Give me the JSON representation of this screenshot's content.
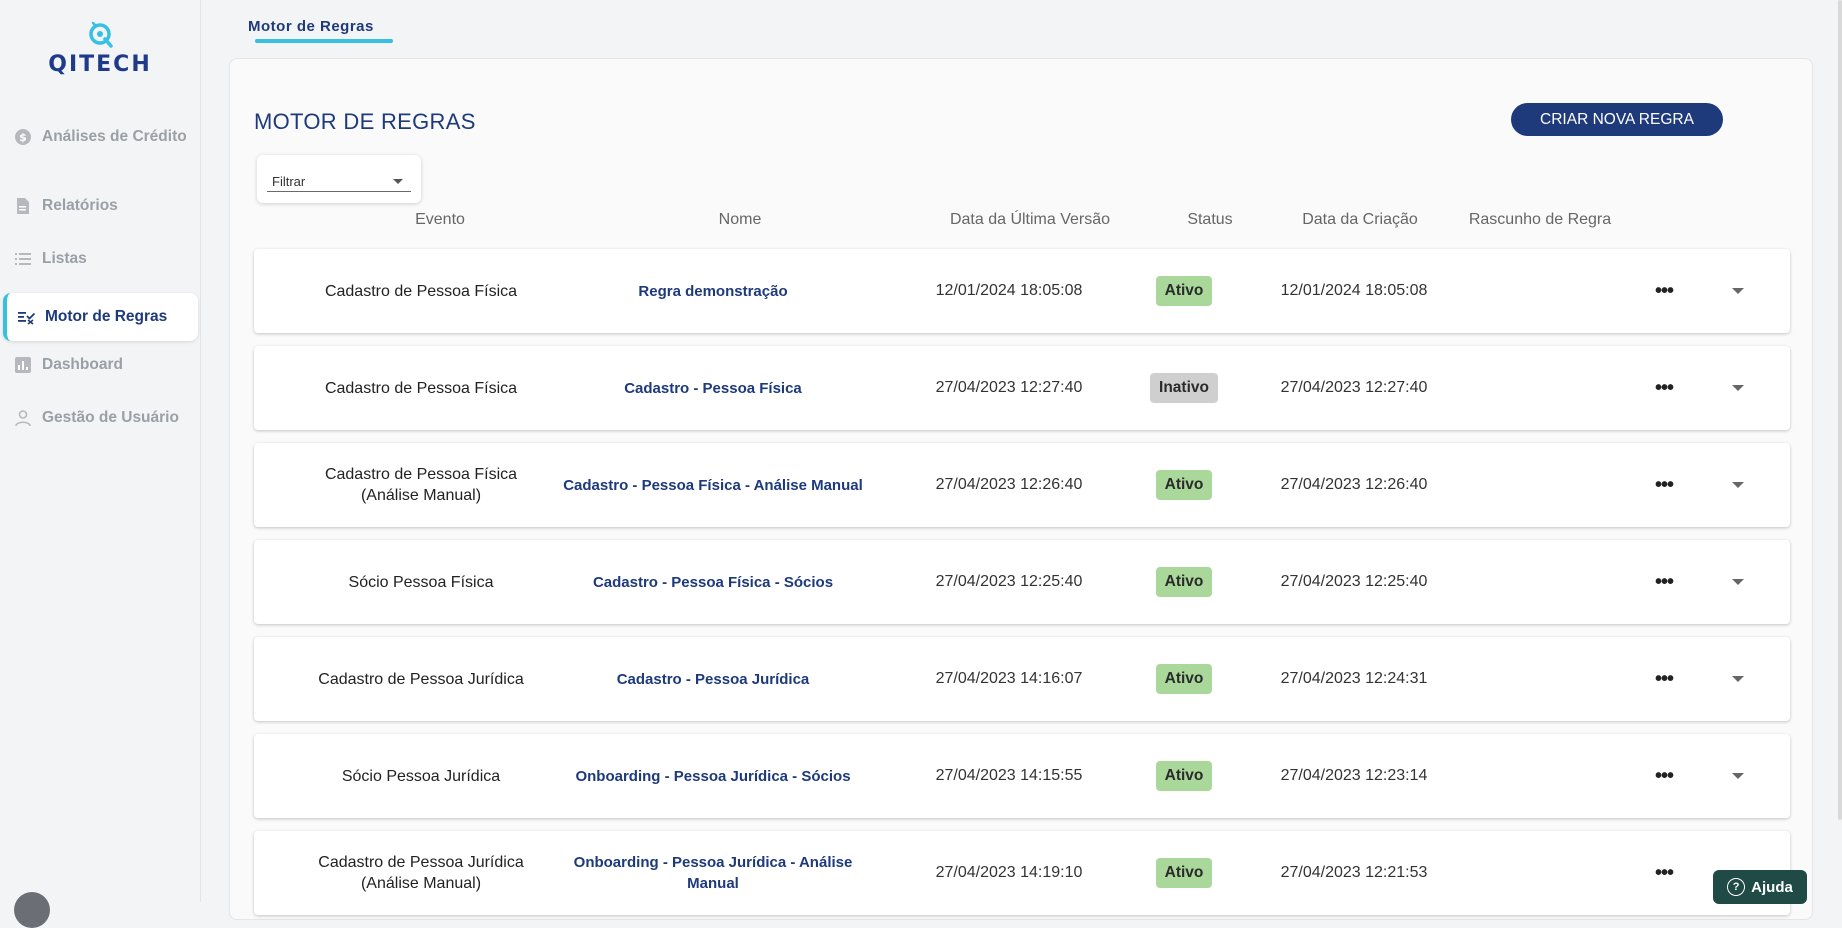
{
  "brand": {
    "name": "QITECH"
  },
  "sidebar": {
    "items": [
      {
        "label": "Análises de Crédito",
        "icon": "dollar-circle-icon"
      },
      {
        "label": "Relatórios",
        "icon": "report-icon"
      },
      {
        "label": "Listas",
        "icon": "list-icon"
      },
      {
        "label": "Motor de Regras",
        "icon": "rules-icon",
        "active": true
      },
      {
        "label": "Dashboard",
        "icon": "bar-chart-icon"
      },
      {
        "label": "Gestão de Usuário",
        "icon": "user-icon"
      }
    ]
  },
  "top_tab": {
    "label": "Motor de Regras"
  },
  "main": {
    "title": "MOTOR DE REGRAS",
    "create_button": "CRIAR NOVA REGRA",
    "filter": {
      "label": "Filtrar"
    }
  },
  "table": {
    "columns": [
      "Evento",
      "Nome",
      "Data da Última Versão",
      "Status",
      "Data da Criação",
      "Rascunho de Regra"
    ],
    "rows": [
      {
        "evento": "Cadastro de Pessoa Física",
        "nome": "Regra demonstração",
        "ultima_versao": "12/01/2024 18:05:08",
        "status": "Ativo",
        "criacao": "12/01/2024 18:05:08"
      },
      {
        "evento": "Cadastro de Pessoa Física",
        "nome": "Cadastro - Pessoa Física",
        "ultima_versao": "27/04/2023 12:27:40",
        "status": "Inativo",
        "criacao": "27/04/2023 12:27:40"
      },
      {
        "evento": "Cadastro de Pessoa Física (Análise Manual)",
        "nome": "Cadastro - Pessoa Física - Análise Manual",
        "ultima_versao": "27/04/2023 12:26:40",
        "status": "Ativo",
        "criacao": "27/04/2023 12:26:40"
      },
      {
        "evento": "Sócio Pessoa Física",
        "nome": "Cadastro - Pessoa Física - Sócios",
        "ultima_versao": "27/04/2023 12:25:40",
        "status": "Ativo",
        "criacao": "27/04/2023 12:25:40"
      },
      {
        "evento": "Cadastro de Pessoa Jurídica",
        "nome": "Cadastro - Pessoa Jurídica",
        "ultima_versao": "27/04/2023 14:16:07",
        "status": "Ativo",
        "criacao": "27/04/2023 12:24:31"
      },
      {
        "evento": "Sócio Pessoa Jurídica",
        "nome": "Onboarding - Pessoa Jurídica - Sócios",
        "ultima_versao": "27/04/2023 14:15:55",
        "status": "Ativo",
        "criacao": "27/04/2023 12:23:14"
      },
      {
        "evento": "Cadastro de Pessoa Jurídica (Análise Manual)",
        "nome": "Onboarding - Pessoa Jurídica - Análise Manual",
        "ultima_versao": "27/04/2023 14:19:10",
        "status": "Ativo",
        "criacao": "27/04/2023 12:21:53"
      }
    ]
  },
  "help": {
    "label": "Ajuda"
  },
  "colors": {
    "primary": "#1e3a7b",
    "accent": "#38c0e2",
    "active_badge": "#a9d89a",
    "inactive_badge": "#cfcfcf",
    "help_button": "#1f4a45"
  }
}
